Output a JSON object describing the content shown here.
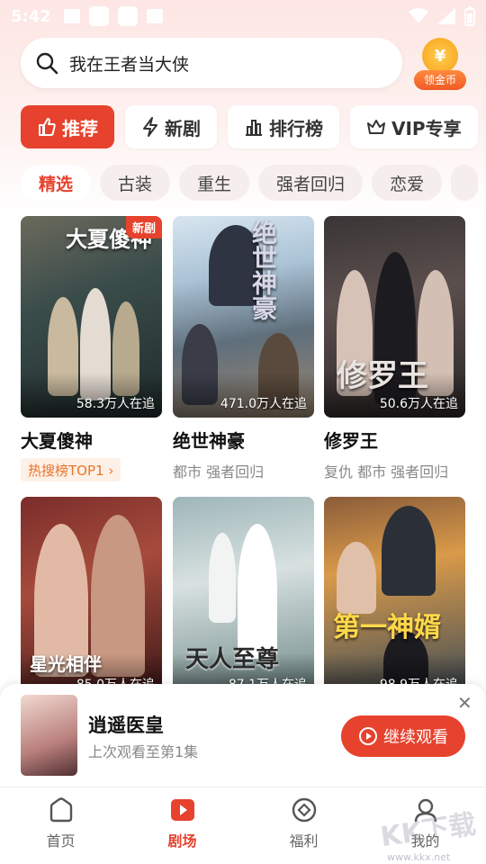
{
  "status_bar": {
    "time": "5:42"
  },
  "search": {
    "query": "我在王者当大侠"
  },
  "coin_widget": {
    "symbol": "¥",
    "label": "领金币"
  },
  "tabs": [
    {
      "label": "推荐",
      "icon": "thumbs-up-icon",
      "active": true
    },
    {
      "label": "新剧",
      "icon": "lightning-icon"
    },
    {
      "label": "排行榜",
      "icon": "bar-chart-icon"
    },
    {
      "label": "VIP专享",
      "icon": "crown-icon"
    }
  ],
  "categories": [
    "精选",
    "古装",
    "重生",
    "强者回归",
    "恋爱"
  ],
  "dramas": [
    {
      "title": "大夏傻神",
      "watching": "58.3万人在追",
      "badge": "新剧",
      "hot_tag": "热搜榜TOP1 ›",
      "poster_text": "大夏傻神"
    },
    {
      "title": "绝世神豪",
      "watching": "471.0万人在追",
      "tags": "都市 强者回归",
      "poster_text": "绝世神豪"
    },
    {
      "title": "修罗王",
      "watching": "50.6万人在追",
      "tags": "复仇 都市 强者回归",
      "poster_text": "修罗王"
    },
    {
      "title": "星光相伴",
      "watching": "85.0万人在追",
      "poster_text": "星光相伴"
    },
    {
      "title": "天人至尊",
      "watching": "87.1万人在追",
      "poster_text": "天人至尊"
    },
    {
      "title": "第一神婿",
      "watching": "98.9万人在追",
      "poster_text": "第一神婿"
    }
  ],
  "continue_watching": {
    "title": "逍遥医皇",
    "progress": "上次观看至第1集",
    "button": "继续观看"
  },
  "bottom_nav": [
    {
      "label": "首页",
      "icon": "home-icon"
    },
    {
      "label": "剧场",
      "icon": "play-icon",
      "active": true
    },
    {
      "label": "福利",
      "icon": "gift-diamond-icon"
    },
    {
      "label": "我的",
      "icon": "profile-icon"
    }
  ],
  "watermark": {
    "text": "KK下载",
    "url": "www.kkx.net"
  },
  "colors": {
    "accent": "#e6422d",
    "hot": "#e8742b"
  }
}
